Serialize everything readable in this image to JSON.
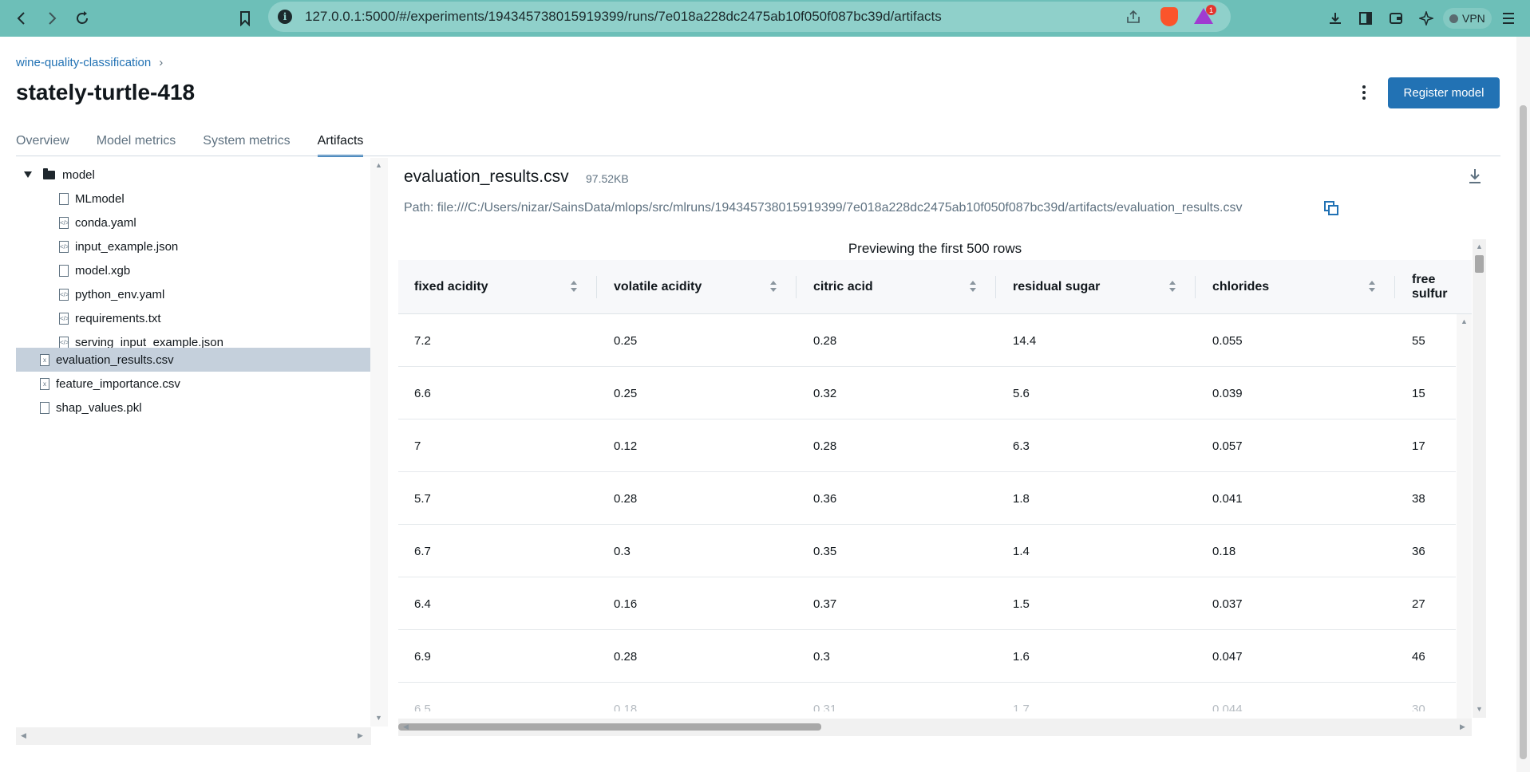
{
  "browser": {
    "url": "127.0.0.1:5000/#/experiments/194345738015919399/runs/7e018a228dc2475ab10f050f087bc39d/artifacts",
    "vpn_label": "VPN",
    "notification_count": "1"
  },
  "breadcrumb": {
    "experiment": "wine-quality-classification",
    "separator": "›"
  },
  "run": {
    "title": "stately-turtle-418",
    "register_label": "Register model"
  },
  "tabs": [
    {
      "label": "Overview"
    },
    {
      "label": "Model metrics"
    },
    {
      "label": "System metrics"
    },
    {
      "label": "Artifacts",
      "active": true
    }
  ],
  "tree": {
    "folder": "model",
    "model_files": [
      "MLmodel",
      "conda.yaml",
      "input_example.json",
      "model.xgb",
      "python_env.yaml",
      "requirements.txt",
      "serving_input_example.json"
    ],
    "root_files": [
      "evaluation_results.csv",
      "feature_importance.csv",
      "shap_values.pkl"
    ],
    "selected": "evaluation_results.csv"
  },
  "artifact": {
    "name": "evaluation_results.csv",
    "size": "97.52KB",
    "path": "Path: file:///C:/Users/nizar/SainsData/mlops/src/mlruns/194345738015919399/7e018a228dc2475ab10f050f087bc39d/artifacts/evaluation_results.csv",
    "preview_label": "Previewing the first 500 rows"
  },
  "table": {
    "columns": [
      "fixed acidity",
      "volatile acidity",
      "citric acid",
      "residual sugar",
      "chlorides",
      "free sulfur"
    ],
    "rows": [
      [
        "7.2",
        "0.25",
        "0.28",
        "14.4",
        "0.055",
        "55"
      ],
      [
        "6.6",
        "0.25",
        "0.32",
        "5.6",
        "0.039",
        "15"
      ],
      [
        "7",
        "0.12",
        "0.28",
        "6.3",
        "0.057",
        "17"
      ],
      [
        "5.7",
        "0.28",
        "0.36",
        "1.8",
        "0.041",
        "38"
      ],
      [
        "6.7",
        "0.3",
        "0.35",
        "1.4",
        "0.18",
        "36"
      ],
      [
        "6.4",
        "0.16",
        "0.37",
        "1.5",
        "0.037",
        "27"
      ],
      [
        "6.9",
        "0.28",
        "0.3",
        "1.6",
        "0.047",
        "46"
      ],
      [
        "6.5",
        "0.18",
        "0.31",
        "1.7",
        "0.044",
        "30"
      ]
    ]
  },
  "colors": {
    "accent": "#2272b4",
    "chrome": "#6dbfb8",
    "selected_row": "#c5d0dc"
  }
}
